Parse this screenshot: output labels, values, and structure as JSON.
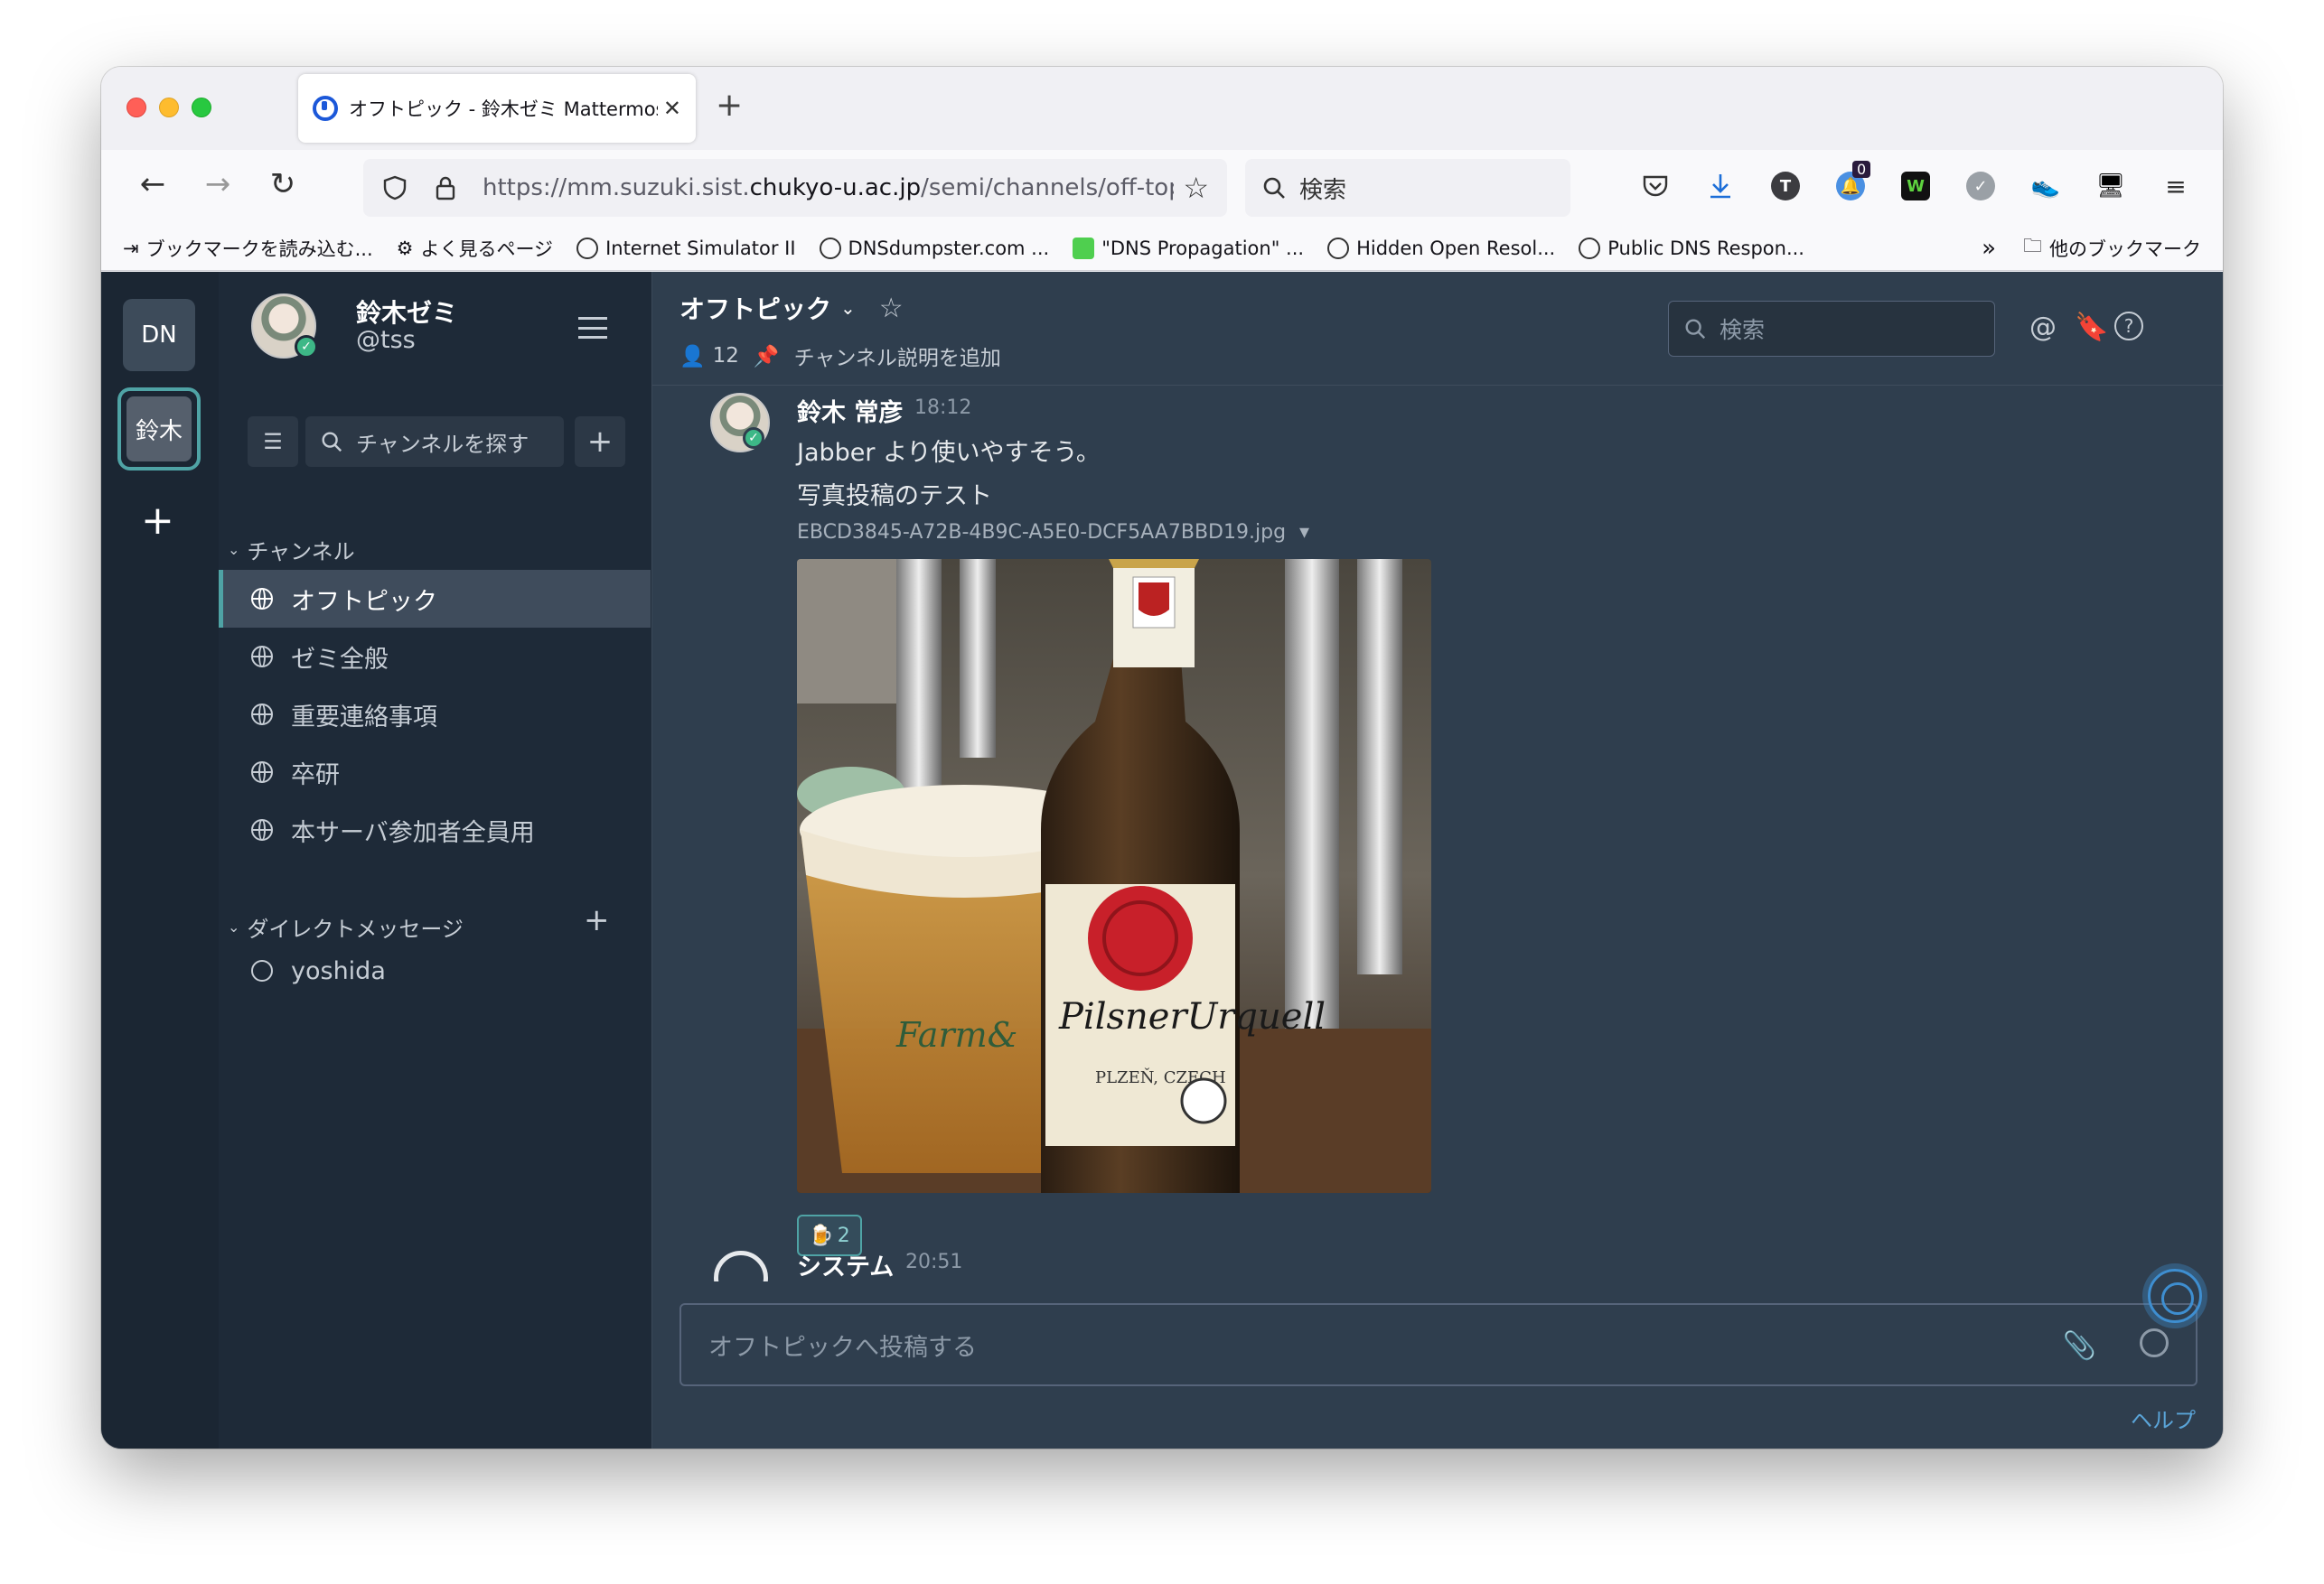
{
  "browser": {
    "tab_title": "オフトピック - 鈴木ゼミ Mattermost",
    "url_prefix": "https://mm.suzuki.sist.",
    "url_domain": "chukyo-u.ac.jp",
    "url_path": "/semi/channels/off-topic",
    "search_placeholder": "検索",
    "notification_badge": "0",
    "bookmarks": [
      "ブックマークを読み込む...",
      "よく見るページ",
      "Internet Simulator II",
      "DNSdumpster.com ...",
      "\"DNS Propagation\" ...",
      "Hidden Open Resol...",
      "Public DNS Respon..."
    ],
    "other_bookmarks": "他のブックマーク"
  },
  "teams": {
    "dn": "DN",
    "suzuki": "鈴木"
  },
  "sidebar": {
    "team_name": "鈴木ゼミ",
    "user_handle": "@tss",
    "find_channel": "チャンネルを探す",
    "channels_header": "チャンネル",
    "channels": [
      "オフトピック",
      "ゼミ全般",
      "重要連絡事項",
      "卒研",
      "本サーバ参加者全員用"
    ],
    "dm_header": "ダイレクトメッセージ",
    "dms": [
      "yoshida"
    ]
  },
  "channel": {
    "name": "オフトピック",
    "member_count": "12",
    "add_description": "チャンネル説明を追加",
    "search_placeholder": "検索"
  },
  "posts": [
    {
      "author": "鈴木 常彦",
      "time": "18:12",
      "lines": [
        "Jabber より使いやすそう。",
        "写真投稿のテスト"
      ],
      "file_name": "EBCD3845-A72B-4B9C-A5E0-DCF5AA7BBD19.jpg",
      "reaction_count": "2"
    },
    {
      "author": "システム",
      "time": "20:51"
    }
  ],
  "composer": {
    "placeholder": "オフトピックへ投稿する"
  },
  "help_link": "ヘルプ",
  "colors": {
    "team_sidebar": "#1b2633",
    "channel_sidebar": "#1e2a38",
    "center": "#2f3e4e",
    "accent": "#4fa3a5",
    "link": "#5aa4d8"
  }
}
